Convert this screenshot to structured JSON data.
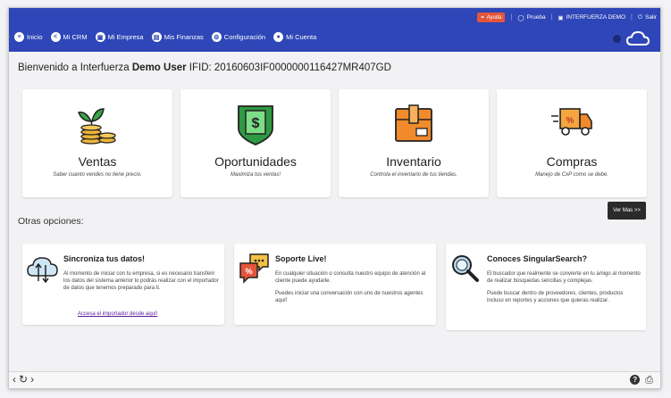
{
  "util": {
    "help_label": "Ayuda",
    "user_label": "Prueba",
    "company_label": "INTERFUERZA DEMO",
    "logout_label": "Salir"
  },
  "nav": [
    {
      "label": "Inicio",
      "icon": "home-icon"
    },
    {
      "label": "Mi CRM",
      "icon": "share-icon"
    },
    {
      "label": "Mi Empresa",
      "icon": "office-icon"
    },
    {
      "label": "Mis Finanzas",
      "icon": "finance-icon"
    },
    {
      "label": "Configuración",
      "icon": "gear-icon"
    },
    {
      "label": "Mi Cuenta",
      "icon": "user-icon"
    }
  ],
  "welcome": {
    "prefix": "Bienvenido a Interfuerza",
    "user": "Demo User",
    "ifid": "IFID: 20160603IF0000000116427MR407GD"
  },
  "cards": [
    {
      "title": "Ventas",
      "desc": "Saber cuanto vendes no tiene precio.",
      "icon": "money-plant-icon"
    },
    {
      "title": "Oportunidades",
      "desc": "Maximiza tus ventas!",
      "icon": "shield-dollar-icon"
    },
    {
      "title": "Inventario",
      "desc": "Controla el inventario de tus tiendas.",
      "icon": "box-icon"
    },
    {
      "title": "Compras",
      "desc": "Manejo de CxP como se debe.",
      "icon": "truck-icon"
    }
  ],
  "ver_mas": "Ver Mas >>",
  "otras": "Otras opciones:",
  "options": [
    {
      "title": "Sincroniza tus datos!",
      "text": "Al momento de iniciar con tu empresa, si es necesario transferir los datos del sistema anterior lo podrás realizar con el importador de datos que tenemos preparado para ti.",
      "link": "Accesa el importador desde aquí!",
      "icon": "cloud-sync-icon"
    },
    {
      "title": "Soporte Live!",
      "text": "En cualquier situación o consulta nuestro equipo de atención al cliente puede ayudarle.",
      "text2": "Puedes iniciar una conversación con uno de nuestros agentes aquí!",
      "icon": "chat-bubbles-icon"
    },
    {
      "title": "Conoces SingularSearch?",
      "text": "El buscador que realmente se convierte en tu amigo al momento de realizar búsquedas sencillas y complejas.",
      "text2": "Puede buscar dentro de proveedores, clientes, productos incluso en reportes y acciones que quieras realizar.",
      "icon": "magnifier-icon"
    }
  ],
  "colors": {
    "topbar": "#2e46b7",
    "help_badge": "#e4553a",
    "link": "#5a1a9a"
  }
}
